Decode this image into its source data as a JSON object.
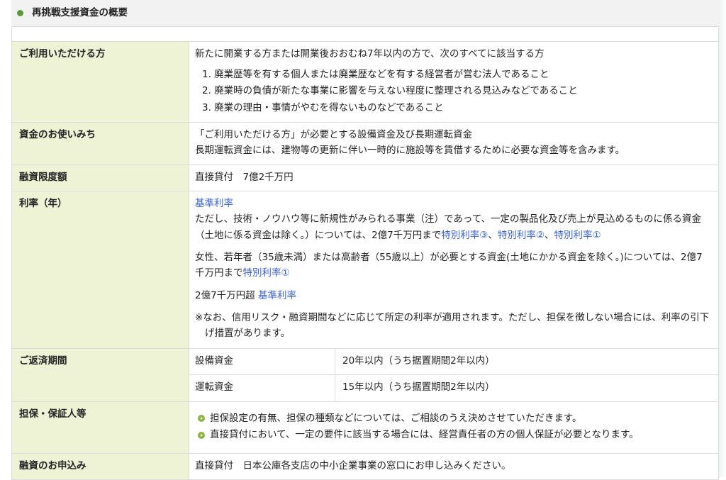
{
  "header": {
    "title": "再挑戦支援資金の概要"
  },
  "rows": {
    "eligibility": {
      "label": "ご利用いただける方",
      "intro": "新たに開業する方または開業後おおむね7年以内の方で、次のすべてに該当する方",
      "items": [
        "1. 廃業歴等を有する個人または廃業歴などを有する経営者が営む法人であること",
        "2. 廃業時の負債が新たな事業に影響を与えない程度に整理される見込みなどであること",
        "3. 廃業の理由・事情がやむを得ないものなどであること"
      ]
    },
    "usage": {
      "label": "資金のお使いみち",
      "line1": "「ご利用いただける方」が必要とする設備資金及び長期運転資金",
      "line2": "長期運転資金には、建物等の更新に伴い一時的に施設等を賃借するために必要な資金等を含みます。"
    },
    "limit": {
      "label": "融資限度額",
      "value": "直接貸付　7億2千万円"
    },
    "rate": {
      "label": "利率（年）",
      "base_link": "基準利率",
      "p1_text": "ただし、技術・ノウハウ等に新規性がみられる事業（注）であって、一定の製品化及び売上が見込めるものに係る資金（土地に係る資金は除く。）については、2億7千万円まで",
      "p1_link3": "特別利率③",
      "sep1": "、",
      "p1_link2": "特別利率②",
      "sep2": "、",
      "p1_link1": "特別利率①",
      "p2_text": "女性、若年者（35歳未満）または高齢者（55歳以上）が必要とする資金(土地にかかる資金を除く。)については、2億7千万円まで",
      "p2_link": "特別利率①",
      "p3_text": "2億7千万円超 ",
      "p3_link": "基準利率",
      "note": "※なお、信用リスク・融資期間などに応じて所定の利率が適用されます。ただし、担保を徴しない場合には、利率の引下げ措置があります。"
    },
    "repayment": {
      "label": "ご返済期間",
      "items": [
        {
          "kind": "設備資金",
          "term": "20年以内（うち据置期間2年以内）"
        },
        {
          "kind": "運転資金",
          "term": "15年以内（うち据置期間2年以内）"
        }
      ]
    },
    "collateral": {
      "label": "担保・保証人等",
      "items": [
        "担保設定の有無、担保の種類などについては、ご相談のうえ決めさせていただきます。",
        "直接貸付において、一定の要件に該当する場合には、経営責任者の方の個人保証が必要となります。"
      ]
    },
    "application": {
      "label": "融資のお申込み",
      "value": "直接貸付　日本公庫各支店の中小企業事業の窓口にお申し込みください。"
    }
  },
  "colors": {
    "label_bg": "#eef3d6",
    "link": "#3a63c8",
    "bullet": "#8ab83f",
    "header_dot": "#5a9a3a"
  }
}
